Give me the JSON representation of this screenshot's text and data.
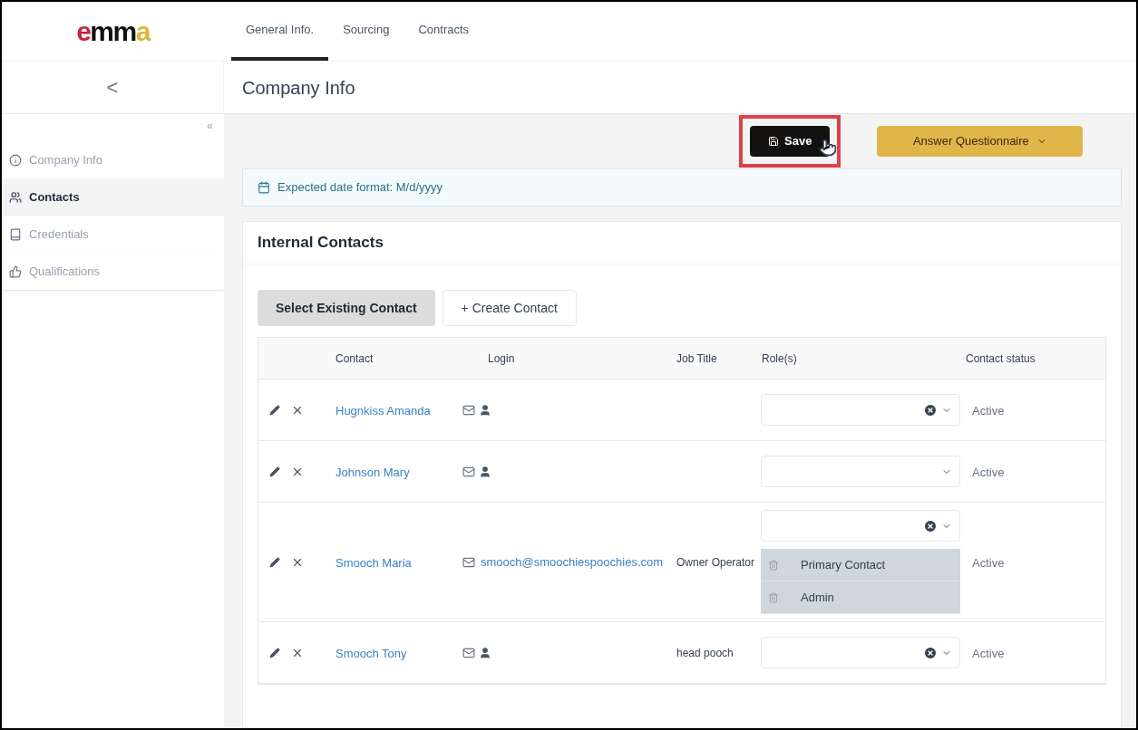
{
  "logo": [
    {
      "text": "e",
      "color": "#c4253c"
    },
    {
      "text": "mm",
      "color": "#111111"
    },
    {
      "text": "a",
      "color": "#e2b43a"
    }
  ],
  "tabs": [
    {
      "label": "General Info.",
      "selected": true
    },
    {
      "label": "Sourcing",
      "selected": false
    },
    {
      "label": "Contracts",
      "selected": false
    }
  ],
  "back_label": "<",
  "page_title": "Company Info",
  "collapse_label": "«",
  "sidebar": {
    "items": [
      {
        "label": "Company Info",
        "selected": false
      },
      {
        "label": "Contacts",
        "selected": true
      },
      {
        "label": "Credentials",
        "selected": false
      },
      {
        "label": "Qualifications",
        "selected": false
      }
    ]
  },
  "toolbar": {
    "save": {
      "label": "Save",
      "highlighted": true
    },
    "questionnaire": {
      "label": "Answer Questionnaire"
    }
  },
  "notice": "Expected date format: M/d/yyyy",
  "section": {
    "title": "Internal Contacts",
    "buttons": [
      {
        "label": "Select Existing Contact",
        "selected": true
      },
      {
        "label": "+ Create Contact",
        "selected": false
      }
    ],
    "table": {
      "columns": [
        "Contact",
        "Login",
        "Job Title",
        "Role(s)",
        "Contact status"
      ],
      "rows": [
        {
          "contact": "Hugnkiss Amanda",
          "login": {
            "kind": "icons"
          },
          "roles_clearable": true,
          "status": "Active"
        },
        {
          "contact": "Johnson Mary",
          "login": {
            "kind": "icons"
          },
          "roles_clearable": false,
          "status": "Active"
        },
        {
          "contact": "Smooch Maria",
          "login": {
            "kind": "email",
            "email": "smooch@smoochiespoochies.com"
          },
          "job_title": "Owner Operator",
          "roles_clearable": true,
          "roles": [
            "Primary Contact",
            "Admin"
          ],
          "status": "Active"
        },
        {
          "contact": "Smooch Tony",
          "login": {
            "kind": "icons"
          },
          "job_title": "head pooch",
          "roles_clearable": true,
          "status": "Active"
        }
      ]
    }
  }
}
